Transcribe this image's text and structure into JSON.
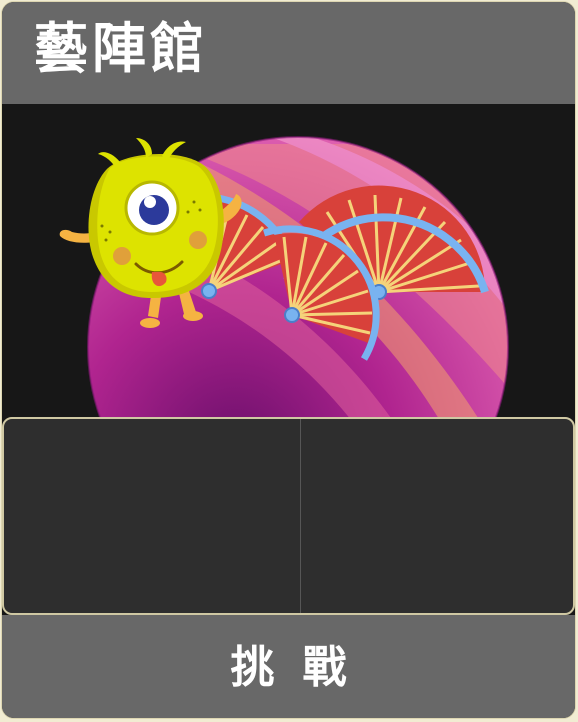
{
  "header": {
    "title": "藝陣館"
  },
  "artwork": {
    "planet": "pink-striped-planet",
    "character": "yellow-one-eyed-monster",
    "props": [
      "red-folding-fan",
      "red-folding-fan",
      "red-folding-fan"
    ]
  },
  "panel": {
    "slots": 2
  },
  "footer": {
    "challenge_label": "挑戰"
  },
  "colors": {
    "header_bg": "#686868",
    "art_bg": "#171717",
    "panel_bg": "#2e2e2e",
    "panel_border": "#cfc8a3",
    "fan_red": "#d8413a",
    "fan_rim": "#79b3f0",
    "monster_yellow": "#d8e000",
    "planet_pink": "#c93aa0"
  }
}
